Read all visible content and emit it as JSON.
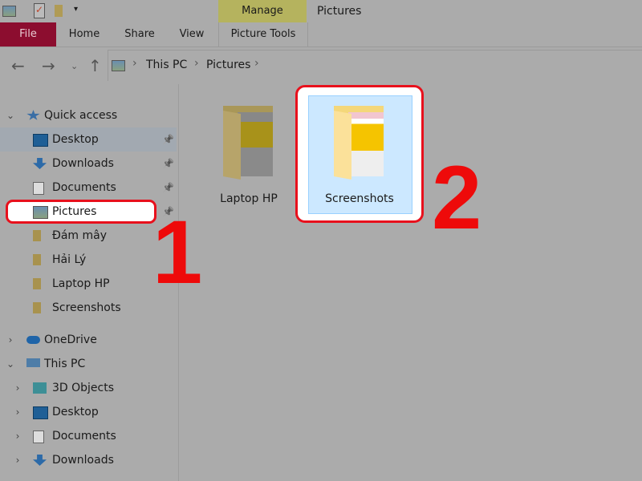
{
  "window_title": "Pictures",
  "ribbon": {
    "file": "File",
    "tabs": [
      "Home",
      "Share",
      "View"
    ],
    "contextual_group": "Manage",
    "contextual_tab": "Picture Tools"
  },
  "address": {
    "crumbs": [
      "This PC",
      "Pictures"
    ]
  },
  "sidebar": {
    "items": [
      {
        "label": "Quick access",
        "icon": "star-icon",
        "level": 0,
        "expand": "expanded"
      },
      {
        "label": "Desktop",
        "icon": "desktop-icon",
        "level": 1,
        "pinned": true,
        "hover": true
      },
      {
        "label": "Downloads",
        "icon": "download-icon",
        "level": 1,
        "pinned": true
      },
      {
        "label": "Documents",
        "icon": "document-icon",
        "level": 1,
        "pinned": true
      },
      {
        "label": "Pictures",
        "icon": "pictures-icon",
        "level": 1,
        "pinned": true,
        "highlight": true
      },
      {
        "label": "Đám mây",
        "icon": "folder-icon",
        "level": 1
      },
      {
        "label": "Hải Lý",
        "icon": "folder-icon",
        "level": 1
      },
      {
        "label": "Laptop HP",
        "icon": "folder-icon",
        "level": 1
      },
      {
        "label": "Screenshots",
        "icon": "folder-icon",
        "level": 1
      },
      {
        "label": "OneDrive",
        "icon": "cloud-icon",
        "level": 0,
        "expand": "collapsed"
      },
      {
        "label": "This PC",
        "icon": "computer-icon",
        "level": 0,
        "expand": "expanded"
      },
      {
        "label": "3D Objects",
        "icon": "cube-icon",
        "level": 1,
        "expand": "collapsed"
      },
      {
        "label": "Desktop",
        "icon": "desktop-icon",
        "level": 1,
        "expand": "collapsed"
      },
      {
        "label": "Documents",
        "icon": "document-icon",
        "level": 1,
        "expand": "collapsed"
      },
      {
        "label": "Downloads",
        "icon": "download-icon",
        "level": 1,
        "expand": "collapsed"
      }
    ]
  },
  "folders": [
    {
      "label": "Laptop HP"
    },
    {
      "label": "Screenshots",
      "selected": true
    }
  ],
  "annotations": [
    "1",
    "2"
  ],
  "colors": {
    "annotation": "#ee0a0a",
    "file_tab": "#8c0d2f",
    "manage": "#b5b35e",
    "selection": "#cce8ff"
  }
}
